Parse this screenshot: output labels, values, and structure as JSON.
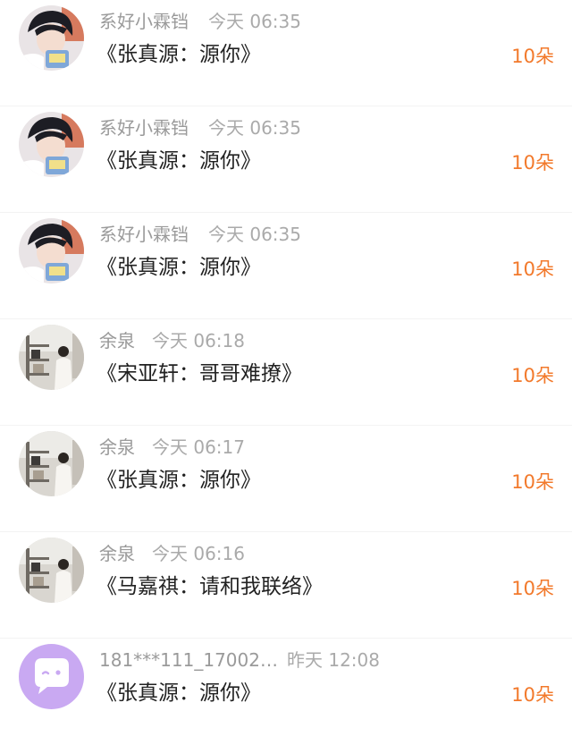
{
  "gifts": [
    {
      "user": "系好小霖铛",
      "time": "今天 06:35",
      "title": "《张真源：源你》",
      "amount": "10朵",
      "avatar": "boy-avatar-icon"
    },
    {
      "user": "系好小霖铛",
      "time": "今天 06:35",
      "title": "《张真源：源你》",
      "amount": "10朵",
      "avatar": "boy-avatar-icon"
    },
    {
      "user": "系好小霖铛",
      "time": "今天 06:35",
      "title": "《张真源：源你》",
      "amount": "10朵",
      "avatar": "boy-avatar-icon"
    },
    {
      "user": "余泉",
      "time": "今天 06:18",
      "title": "《宋亚轩：哥哥难撩》",
      "amount": "10朵",
      "avatar": "girl-room-avatar-icon"
    },
    {
      "user": "余泉",
      "time": "今天 06:17",
      "title": "《张真源：源你》",
      "amount": "10朵",
      "avatar": "girl-room-avatar-icon"
    },
    {
      "user": "余泉",
      "time": "今天 06:16",
      "title": "《马嘉祺：请和我联络》",
      "amount": "10朵",
      "avatar": "girl-room-avatar-icon"
    },
    {
      "user": "181***111_17002…",
      "time": "昨天 12:08",
      "title": "《张真源：源你》",
      "amount": "10朵",
      "avatar": "chat-bubble-avatar-icon"
    }
  ],
  "colors": {
    "amount": "#f2792b",
    "username": "#9a9a9a",
    "title": "#222222",
    "default_avatar_bg": "#c9a9f2"
  }
}
